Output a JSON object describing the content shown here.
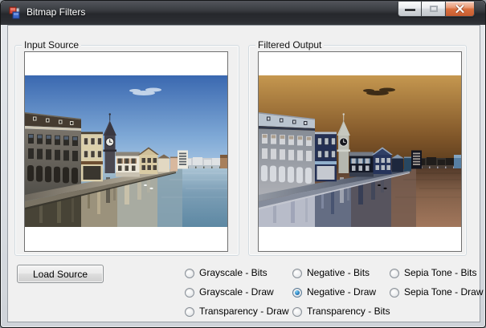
{
  "window": {
    "title": "Bitmap Filters"
  },
  "groups": {
    "input": {
      "label": "Input Source"
    },
    "output": {
      "label": "Filtered Output"
    }
  },
  "buttons": {
    "load_source": "Load Source"
  },
  "filters": {
    "columns": [
      {
        "items": [
          {
            "label": "Grayscale - Bits",
            "state": "unchecked"
          },
          {
            "label": "Grayscale - Draw",
            "state": "unchecked"
          },
          {
            "label": "Transparency - Draw",
            "state": "unchecked"
          }
        ]
      },
      {
        "items": [
          {
            "label": "Negative - Bits",
            "state": "unchecked"
          },
          {
            "label": "Negative - Draw",
            "state": "checked"
          },
          {
            "label": "Transparency - Bits",
            "state": "unchecked"
          }
        ]
      },
      {
        "items": [
          {
            "label": "Sepia Tone - Bits",
            "state": "unchecked"
          },
          {
            "label": "Sepia Tone - Draw",
            "state": "unchecked"
          }
        ]
      }
    ]
  },
  "images": {
    "input_description": "Photo of riverside buildings with a church clock spire under a blue sky",
    "output_description": "Color-negative rendition of the input photo (orange sky, light buildings)",
    "applied_filter": "Negative - Draw"
  },
  "theme": {
    "client_bg": "#f0f0f0",
    "titlebar_dark": "#2c2f34",
    "close_button_red": "#c65c31",
    "radio_accent": "#2f83c0",
    "sky_blue": "#3a68b0",
    "negative_sky_orange": "#c1924d"
  }
}
